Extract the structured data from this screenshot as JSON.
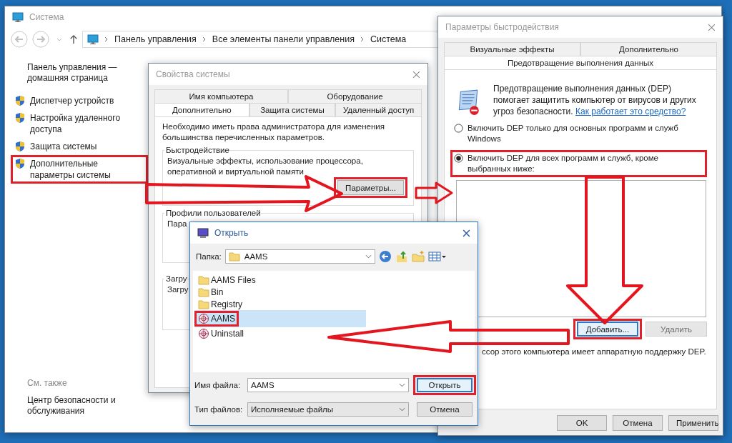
{
  "system_window": {
    "title": "Система",
    "breadcrumb": [
      "Панель управления",
      "Все элементы панели управления",
      "Система"
    ],
    "sidebar": {
      "home_link": "Панель управления — домашняя страница",
      "items": [
        {
          "label": "Диспетчер устройств",
          "highlighted": false
        },
        {
          "label": "Настройка удаленного доступа",
          "highlighted": false
        },
        {
          "label": "Защита системы",
          "highlighted": false
        },
        {
          "label": "Дополнительные параметры системы",
          "highlighted": true
        }
      ],
      "see_also_heading": "См. также",
      "see_also_links": [
        "Центр безопасности и обслуживания"
      ]
    }
  },
  "system_properties": {
    "title": "Свойства системы",
    "tab_rows": [
      [
        {
          "label": "Имя компьютера",
          "selected": false
        },
        {
          "label": "Оборудование",
          "selected": false
        }
      ],
      [
        {
          "label": "Дополнительно",
          "selected": true
        },
        {
          "label": "Защита системы",
          "selected": false
        },
        {
          "label": "Удаленный доступ",
          "selected": false
        }
      ]
    ],
    "intro": "Необходимо иметь права администратора для изменения большинства перечисленных параметров.",
    "groups": [
      {
        "title": "Быстродействие",
        "text": "Визуальные эффекты, использование процессора, оперативной и виртуальной памяти",
        "button": {
          "label": "Параметры...",
          "highlighted": true
        }
      },
      {
        "title": "Профили пользователей",
        "text": "Пара"
      },
      {
        "title": "Загру",
        "text": "Загру"
      }
    ]
  },
  "performance_options": {
    "title": "Параметры быстродействия",
    "tab_rows": [
      [
        {
          "label": "Визуальные эффекты",
          "selected": false
        },
        {
          "label": "Дополнительно",
          "selected": false
        }
      ],
      [
        {
          "label": "Предотвращение выполнения данных",
          "selected": true
        }
      ]
    ],
    "description": "Предотвращение выполнения данных (DEP) помогает защитить компьютер от вирусов и других угроз безопасности.",
    "help_link": "Как работает это средство?",
    "options": [
      {
        "label": "Включить DEP только для основных программ и служб Windows",
        "selected": false,
        "highlighted": false
      },
      {
        "label": "Включить DEP для всех программ и служб, кроме выбранных ниже:",
        "selected": true,
        "highlighted": true
      }
    ],
    "list_buttons": [
      {
        "label": "Добавить...",
        "disabled": false,
        "highlighted": true
      },
      {
        "label": "Удалить",
        "disabled": true,
        "highlighted": false
      }
    ],
    "note": "ссор этого компьютера имеет аппаратную поддержку DEP.",
    "buttons": [
      "OK",
      "Отмена",
      "Применить"
    ]
  },
  "open_dialog": {
    "title": "Открыть",
    "folder_label": "Папка:",
    "folder": "AAMS",
    "files": [
      {
        "name": "AAMS Files",
        "kind": "folder",
        "selected": false,
        "highlighted": false
      },
      {
        "name": "Bin",
        "kind": "folder",
        "selected": false,
        "highlighted": false
      },
      {
        "name": "Registry",
        "kind": "folder",
        "selected": false,
        "highlighted": false
      },
      {
        "name": "AAMS",
        "kind": "app",
        "selected": true,
        "highlighted": true
      },
      {
        "name": "Uninstall",
        "kind": "app",
        "selected": false,
        "highlighted": false
      }
    ],
    "filename_label": "Имя файла:",
    "filename": "AAMS",
    "filetype_label": "Тип файлов:",
    "filetype": "Исполняемые файлы",
    "buttons": [
      {
        "label": "Открыть",
        "default": true,
        "highlighted": true
      },
      {
        "label": "Отмена",
        "default": false,
        "highlighted": false
      }
    ]
  }
}
